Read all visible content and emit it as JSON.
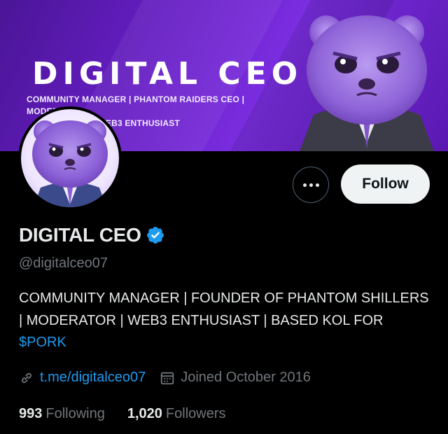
{
  "banner": {
    "title": "DIGITAL CEO",
    "subtitle_line1": "COMMUNITY MANAGER | PHANTOM RAIDERS CEO | MODERATOR",
    "subtitle_line2": "INVESTOR | WEB3 ENTHUSIAST"
  },
  "profile": {
    "display_name": "DIGITAL CEO",
    "handle": "@digitalceo07",
    "bio_text": "COMMUNITY MANAGER | FOUNDER OF PHANTOM SHILLERS | MODERATOR | WEB3 ENTHUSIAST | BASED KOL FOR ",
    "bio_cashtag": "$PORK",
    "link": "t.me/digitalceo07",
    "joined": "Joined October 2016"
  },
  "stats": {
    "following_count": "993",
    "following_label": "Following",
    "followers_count": "1,020",
    "followers_label": "Followers"
  },
  "actions": {
    "follow_label": "Follow",
    "more_icon": "more-horizontal-icon"
  },
  "icons": {
    "verified": "verified-badge-icon",
    "link": "link-icon",
    "calendar": "calendar-icon"
  },
  "colors": {
    "accent_blue": "#1d9bf0",
    "muted_text": "#71767b",
    "banner_purple": "#6a1fc9",
    "follow_button_bg": "#eff3f4"
  }
}
